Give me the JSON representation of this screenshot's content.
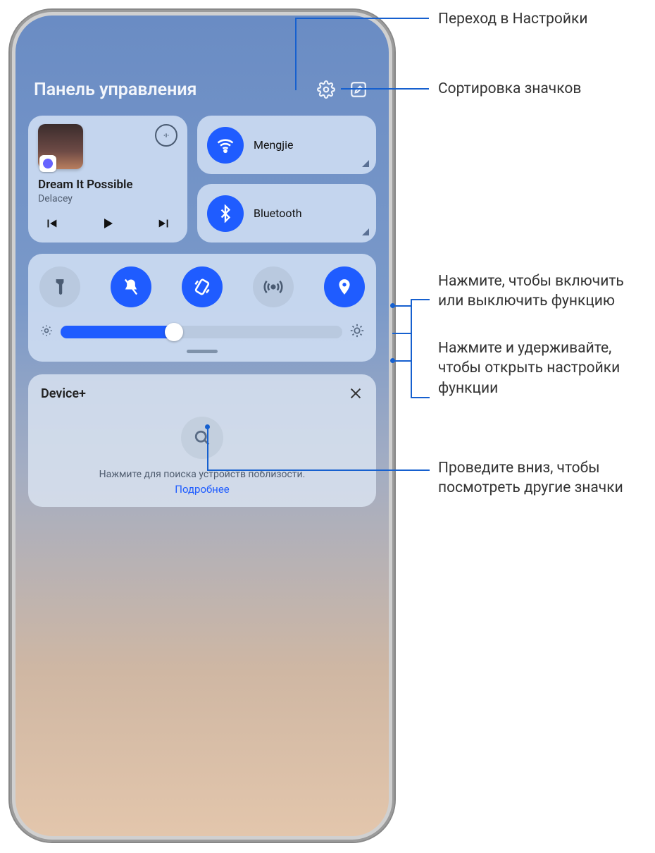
{
  "header": {
    "title": "Панель управления"
  },
  "media": {
    "song": "Dream It Possible",
    "artist": "Delacey"
  },
  "network": {
    "wifi": "Mengjie",
    "bluetooth": "Bluetooth"
  },
  "device": {
    "title": "Device+",
    "hint": "Нажмите для поиска устройств поблизости.",
    "more": "Подробнее"
  },
  "callouts": {
    "settings": "Переход в Настройки",
    "sort": "Сортировка значков",
    "tap": "Нажмите, чтобы включить или выключить функцию",
    "hold": "Нажмите и удерживайте, чтобы открыть настройки функции",
    "swipe": "Проведите вниз, чтобы посмотреть другие значки"
  }
}
